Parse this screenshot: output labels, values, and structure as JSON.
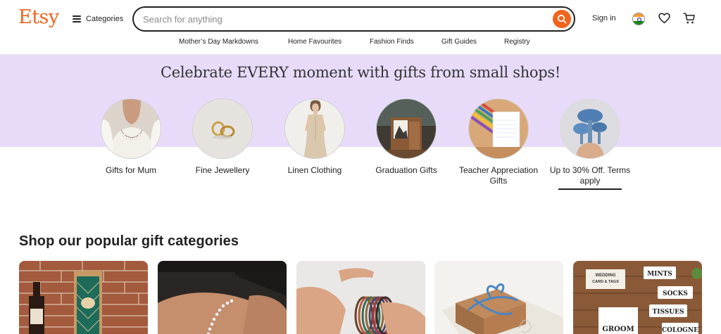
{
  "header": {
    "logo": "Etsy",
    "categories_label": "Categories",
    "search": {
      "placeholder": "Search for anything",
      "value": ""
    },
    "signin_label": "Sign in",
    "region": "India",
    "colors": {
      "accent": "#f1641e",
      "hero_band": "#e8dbfa"
    }
  },
  "nav": {
    "items": [
      {
        "label": "Mother’s Day Markdowns"
      },
      {
        "label": "Home Favourites"
      },
      {
        "label": "Fashion Finds"
      },
      {
        "label": "Gift Guides"
      },
      {
        "label": "Registry"
      }
    ]
  },
  "hero": {
    "title": "Celebrate EVERY moment with gifts from small shops!",
    "items": [
      {
        "label": "Gifts for Mum",
        "icon": "necklace-image"
      },
      {
        "label": "Fine Jewellery",
        "icon": "rings-image"
      },
      {
        "label": "Linen Clothing",
        "icon": "linen-dress-image"
      },
      {
        "label": "Graduation Gifts",
        "icon": "photo-frame-image"
      },
      {
        "label": "Teacher Appreciation Gifts",
        "icon": "pencils-notepad-image"
      },
      {
        "label": "Up to 30% Off. Terms apply",
        "icon": "mushroom-figure-image"
      }
    ]
  },
  "popular": {
    "title": "Shop our popular gift categories",
    "cards": [
      {
        "name": "wine-box-card"
      },
      {
        "name": "bracelet-card"
      },
      {
        "name": "bangles-card"
      },
      {
        "name": "gift-box-card"
      },
      {
        "name": "wedding-tags-card",
        "text": [
          "WEDDING",
          "CARD & TAGS",
          "MINTS",
          "SOCKS",
          "TISSUES",
          "GROOM",
          "COLOGNE"
        ]
      }
    ]
  }
}
